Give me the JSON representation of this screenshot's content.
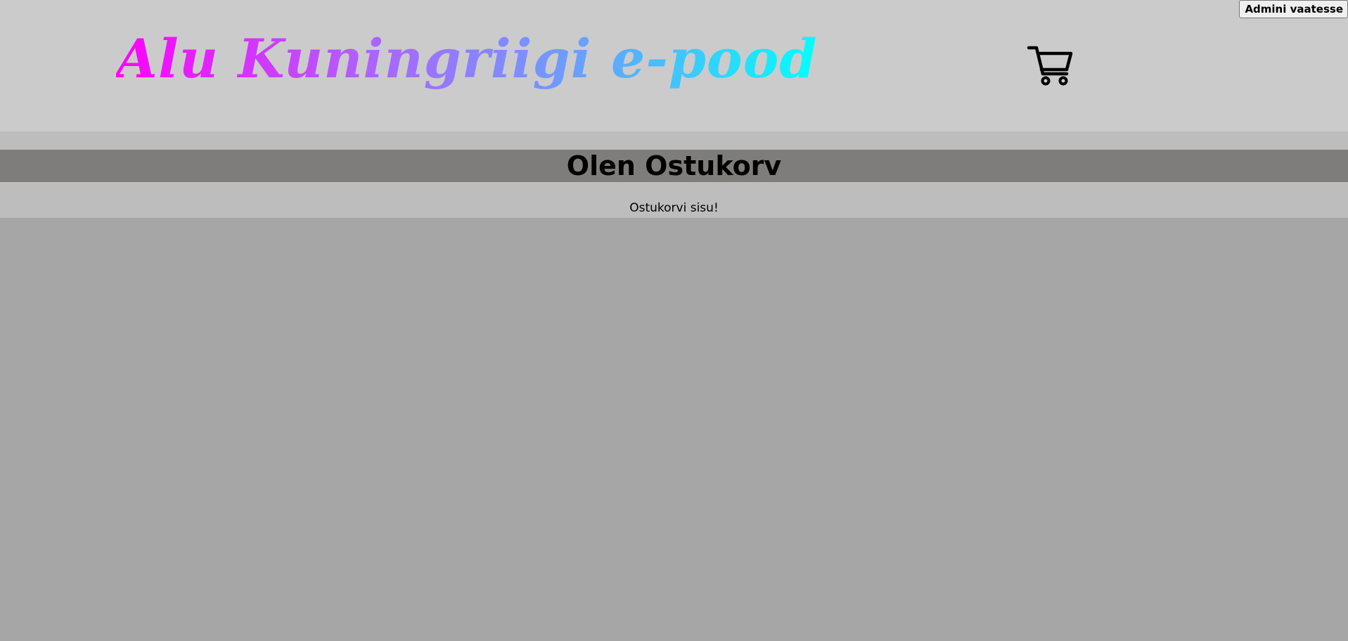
{
  "header": {
    "logo_text": "Alu Kuningriigi e-pood",
    "cart_icon": "shopping-cart-icon",
    "admin_button_label": "Admini vaatesse"
  },
  "main": {
    "title": "Olen Ostukorv",
    "cart_contents_text": "Ostukorvi sisu!"
  },
  "colors": {
    "logo_gradient_start": "#ff00ff",
    "logo_gradient_end": "#00ffff",
    "header_background": "#cbcbcb",
    "title_bar_background": "#7f7d7b",
    "content_background": "#bdbdbd",
    "page_background": "#a6a6a6"
  }
}
